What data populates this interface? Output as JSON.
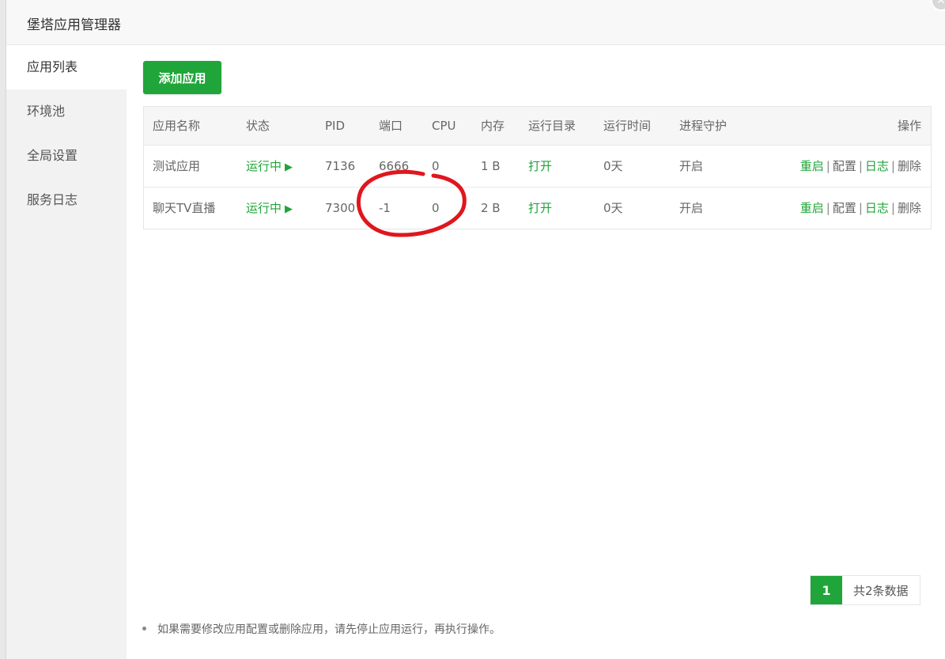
{
  "window": {
    "title": "堡塔应用管理器",
    "close_glyph": "✕"
  },
  "sidebar": {
    "items": [
      {
        "label": "应用列表",
        "active": true
      },
      {
        "label": "环境池",
        "active": false
      },
      {
        "label": "全局设置",
        "active": false
      },
      {
        "label": "服务日志",
        "active": false
      }
    ]
  },
  "toolbar": {
    "add_label": "添加应用"
  },
  "table": {
    "headers": [
      "应用名称",
      "状态",
      "PID",
      "端口",
      "CPU",
      "内存",
      "运行目录",
      "运行时间",
      "进程守护",
      "操作"
    ],
    "rows": [
      {
        "name": "测试应用",
        "status": "运行中",
        "pid": "7136",
        "port": "6666",
        "cpu": "0",
        "mem": "1 B",
        "dir": "打开",
        "uptime": "0天",
        "guard": "开启"
      },
      {
        "name": "聊天TV直播",
        "status": "运行中",
        "pid": "7300",
        "port": "-1",
        "cpu": "0",
        "mem": "2 B",
        "dir": "打开",
        "uptime": "0天",
        "guard": "开启"
      }
    ],
    "actions": {
      "restart": "重启",
      "config": "配置",
      "log": "日志",
      "delete": "删除",
      "separator": "|"
    }
  },
  "pagination": {
    "current": "1",
    "total_text": "共2条数据"
  },
  "tip": "如果需要修改应用配置或删除应用，请先停止应用运行，再执行操作。",
  "colors": {
    "accent": "#20a53a",
    "annotation": "#e0161e"
  }
}
